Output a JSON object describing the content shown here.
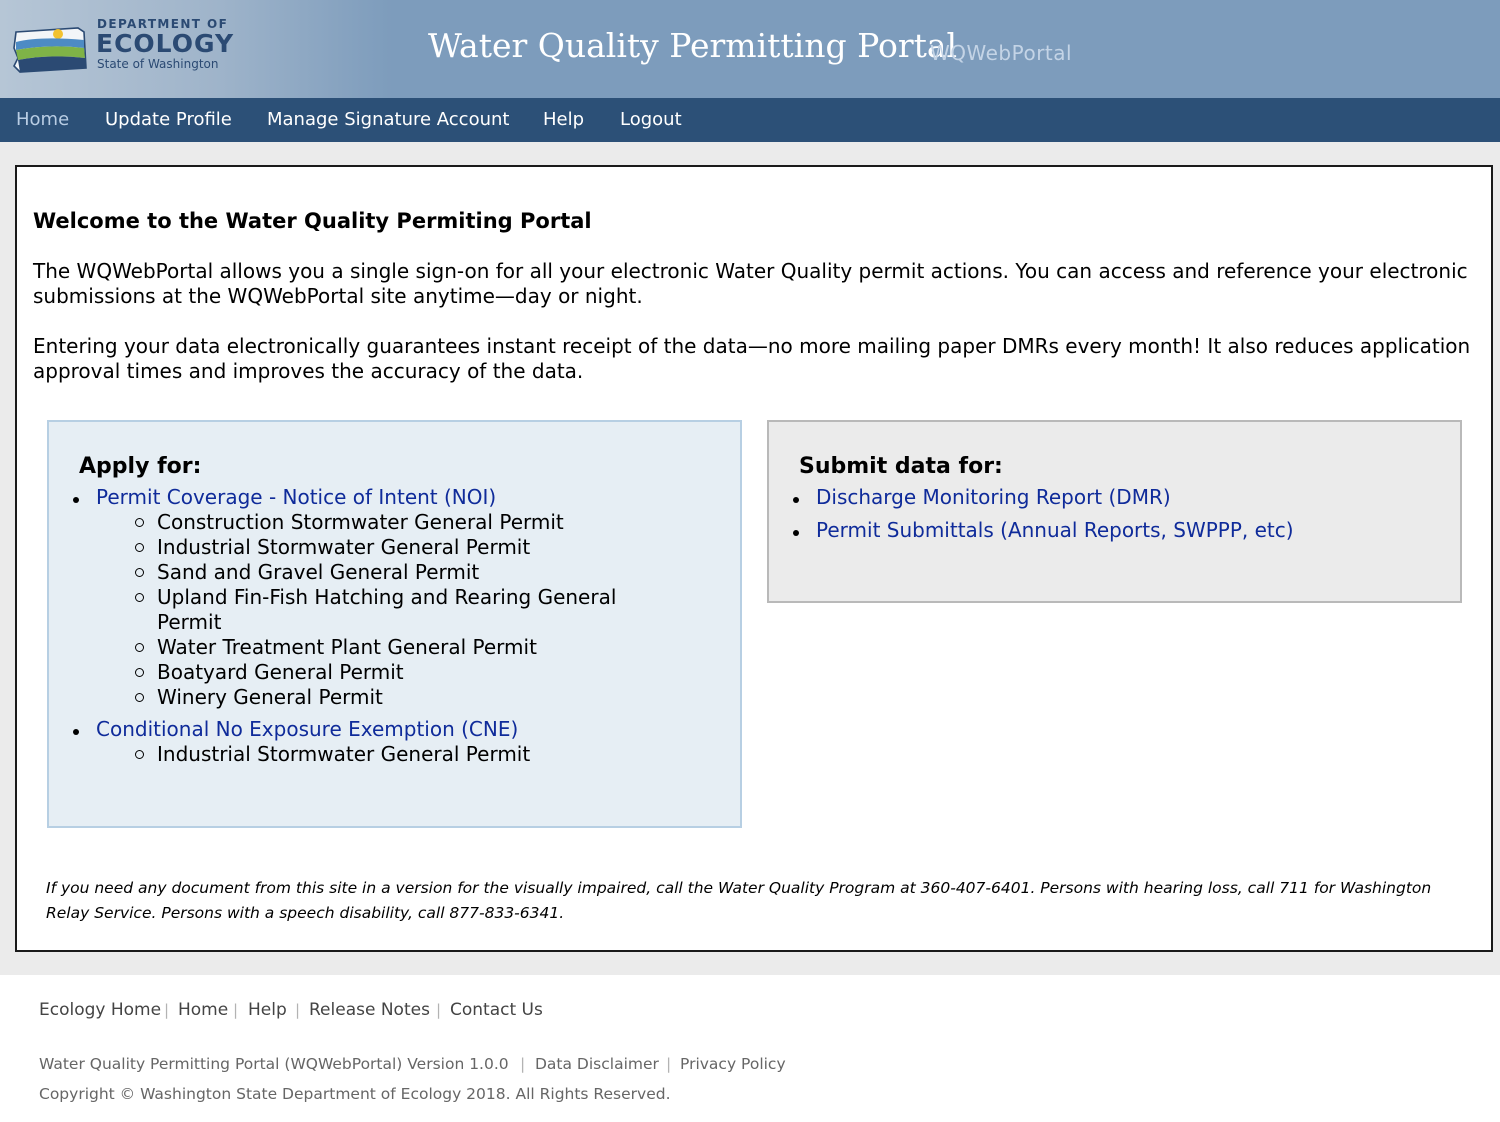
{
  "header": {
    "logo": {
      "dept": "DEPARTMENT OF",
      "name": "ECOLOGY",
      "state": "State of Washington"
    },
    "title": "Water Quality Permitting Portal",
    "subtitle": "WQWebPortal",
    "colors": {
      "header_bg": "#7d9cbc",
      "nav_bg": "#2c5077",
      "link": "#0f2b9a"
    }
  },
  "nav": {
    "items": [
      {
        "label": "Home",
        "active": true
      },
      {
        "label": "Update Profile"
      },
      {
        "label": "Manage Signature Account"
      },
      {
        "label": "Help"
      },
      {
        "label": "Logout"
      }
    ]
  },
  "main": {
    "welcome": "Welcome to the Water Quality Permiting Portal",
    "para1": "The WQWebPortal allows you a single sign-on for all your electronic Water Quality permit actions. You can access and reference your electronic submissions at the WQWebPortal site anytime—day or night.",
    "para2": "Entering your data electronically guarantees instant receipt of the data—no more mailing paper DMRs every month! It also reduces application approval times and improves the accuracy of the data.",
    "apply": {
      "title": "Apply for:",
      "noi_link": "Permit Coverage - Notice of Intent (NOI)",
      "noi_items": [
        "Construction Stormwater General Permit",
        "Industrial Stormwater General Permit",
        "Sand and Gravel General Permit",
        "Upland Fin-Fish Hatching and Rearing General",
        "Permit",
        "Water Treatment Plant General Permit",
        "Boatyard General Permit",
        "Winery General Permit"
      ],
      "cne_link": "Conditional No Exposure Exemption (CNE)",
      "cne_items": [
        "Industrial Stormwater General Permit"
      ]
    },
    "submit": {
      "title": "Submit data for:",
      "links": [
        "Discharge Monitoring Report (DMR)",
        "Permit Submittals (Annual Reports, SWPPP, etc)"
      ]
    },
    "notice": "If you need any document from this site in a version for the visually impaired, call the Water Quality Program at 360-407-6401. Persons with hearing loss, call 711 for Washington Relay Service. Persons with a speech disability, call 877-833-6341."
  },
  "footer": {
    "links": [
      "Ecology Home",
      "Home",
      "Help",
      "Release Notes",
      "Contact Us"
    ],
    "version": "Water Quality Permitting Portal (WQWebPortal) Version 1.0.0",
    "disclaimer": "Data Disclaimer",
    "privacy": "Privacy Policy",
    "copyright": "Copyright © Washington State Department of Ecology 2018. All Rights Reserved."
  }
}
